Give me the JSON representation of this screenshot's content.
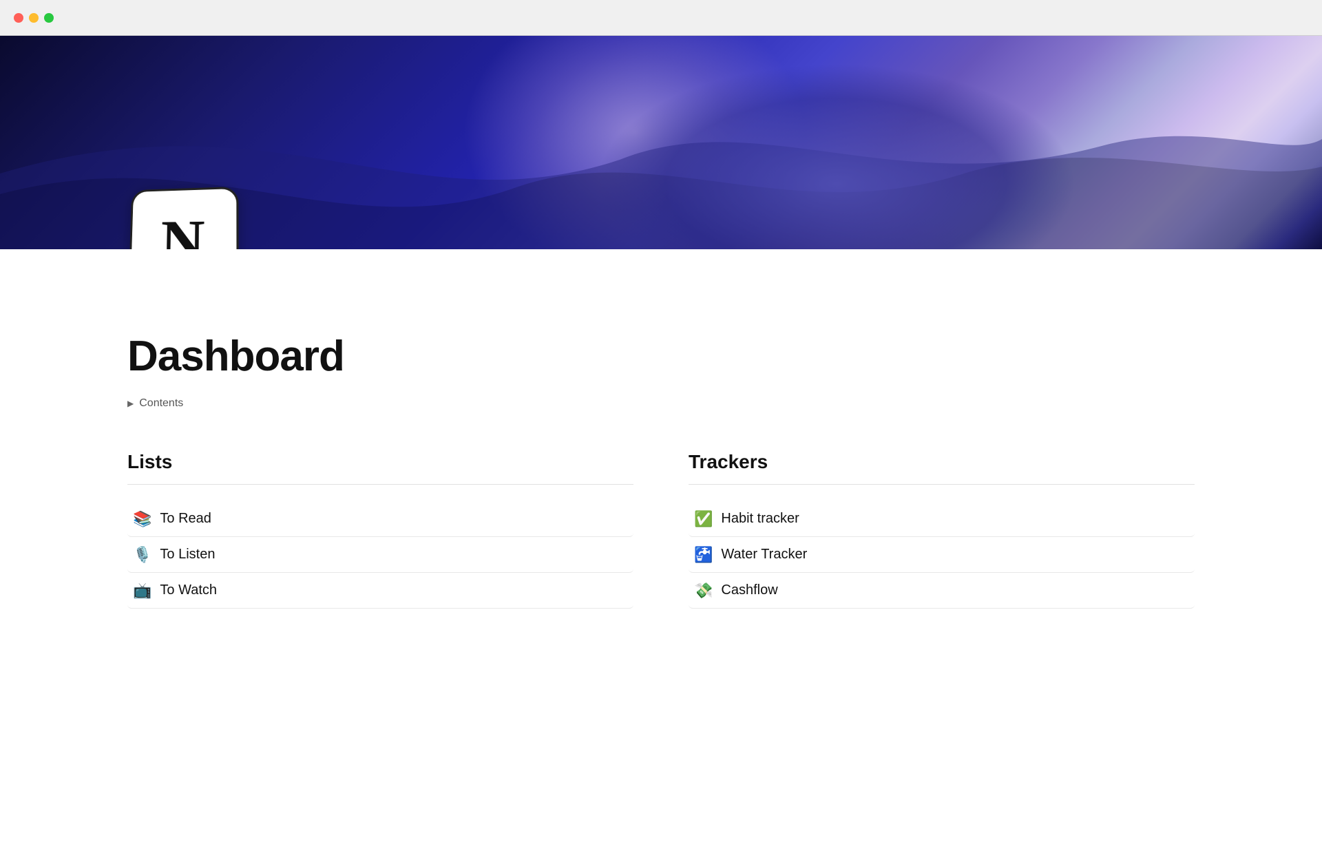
{
  "window": {
    "traffic_lights": [
      "close",
      "minimize",
      "maximize"
    ]
  },
  "hero": {
    "logo_letter": "N"
  },
  "page": {
    "title": "Dashboard",
    "contents_label": "Contents"
  },
  "lists_section": {
    "heading": "Lists",
    "items": [
      {
        "emoji": "📚",
        "label": "To Read"
      },
      {
        "emoji": "🎙️",
        "label": "To Listen"
      },
      {
        "emoji": "📺",
        "label": "To Watch"
      }
    ]
  },
  "trackers_section": {
    "heading": "Trackers",
    "items": [
      {
        "emoji": "✅",
        "label": "Habit tracker"
      },
      {
        "emoji": "🚰",
        "label": "Water Tracker"
      },
      {
        "emoji": "💸",
        "label": "Cashflow"
      }
    ]
  }
}
